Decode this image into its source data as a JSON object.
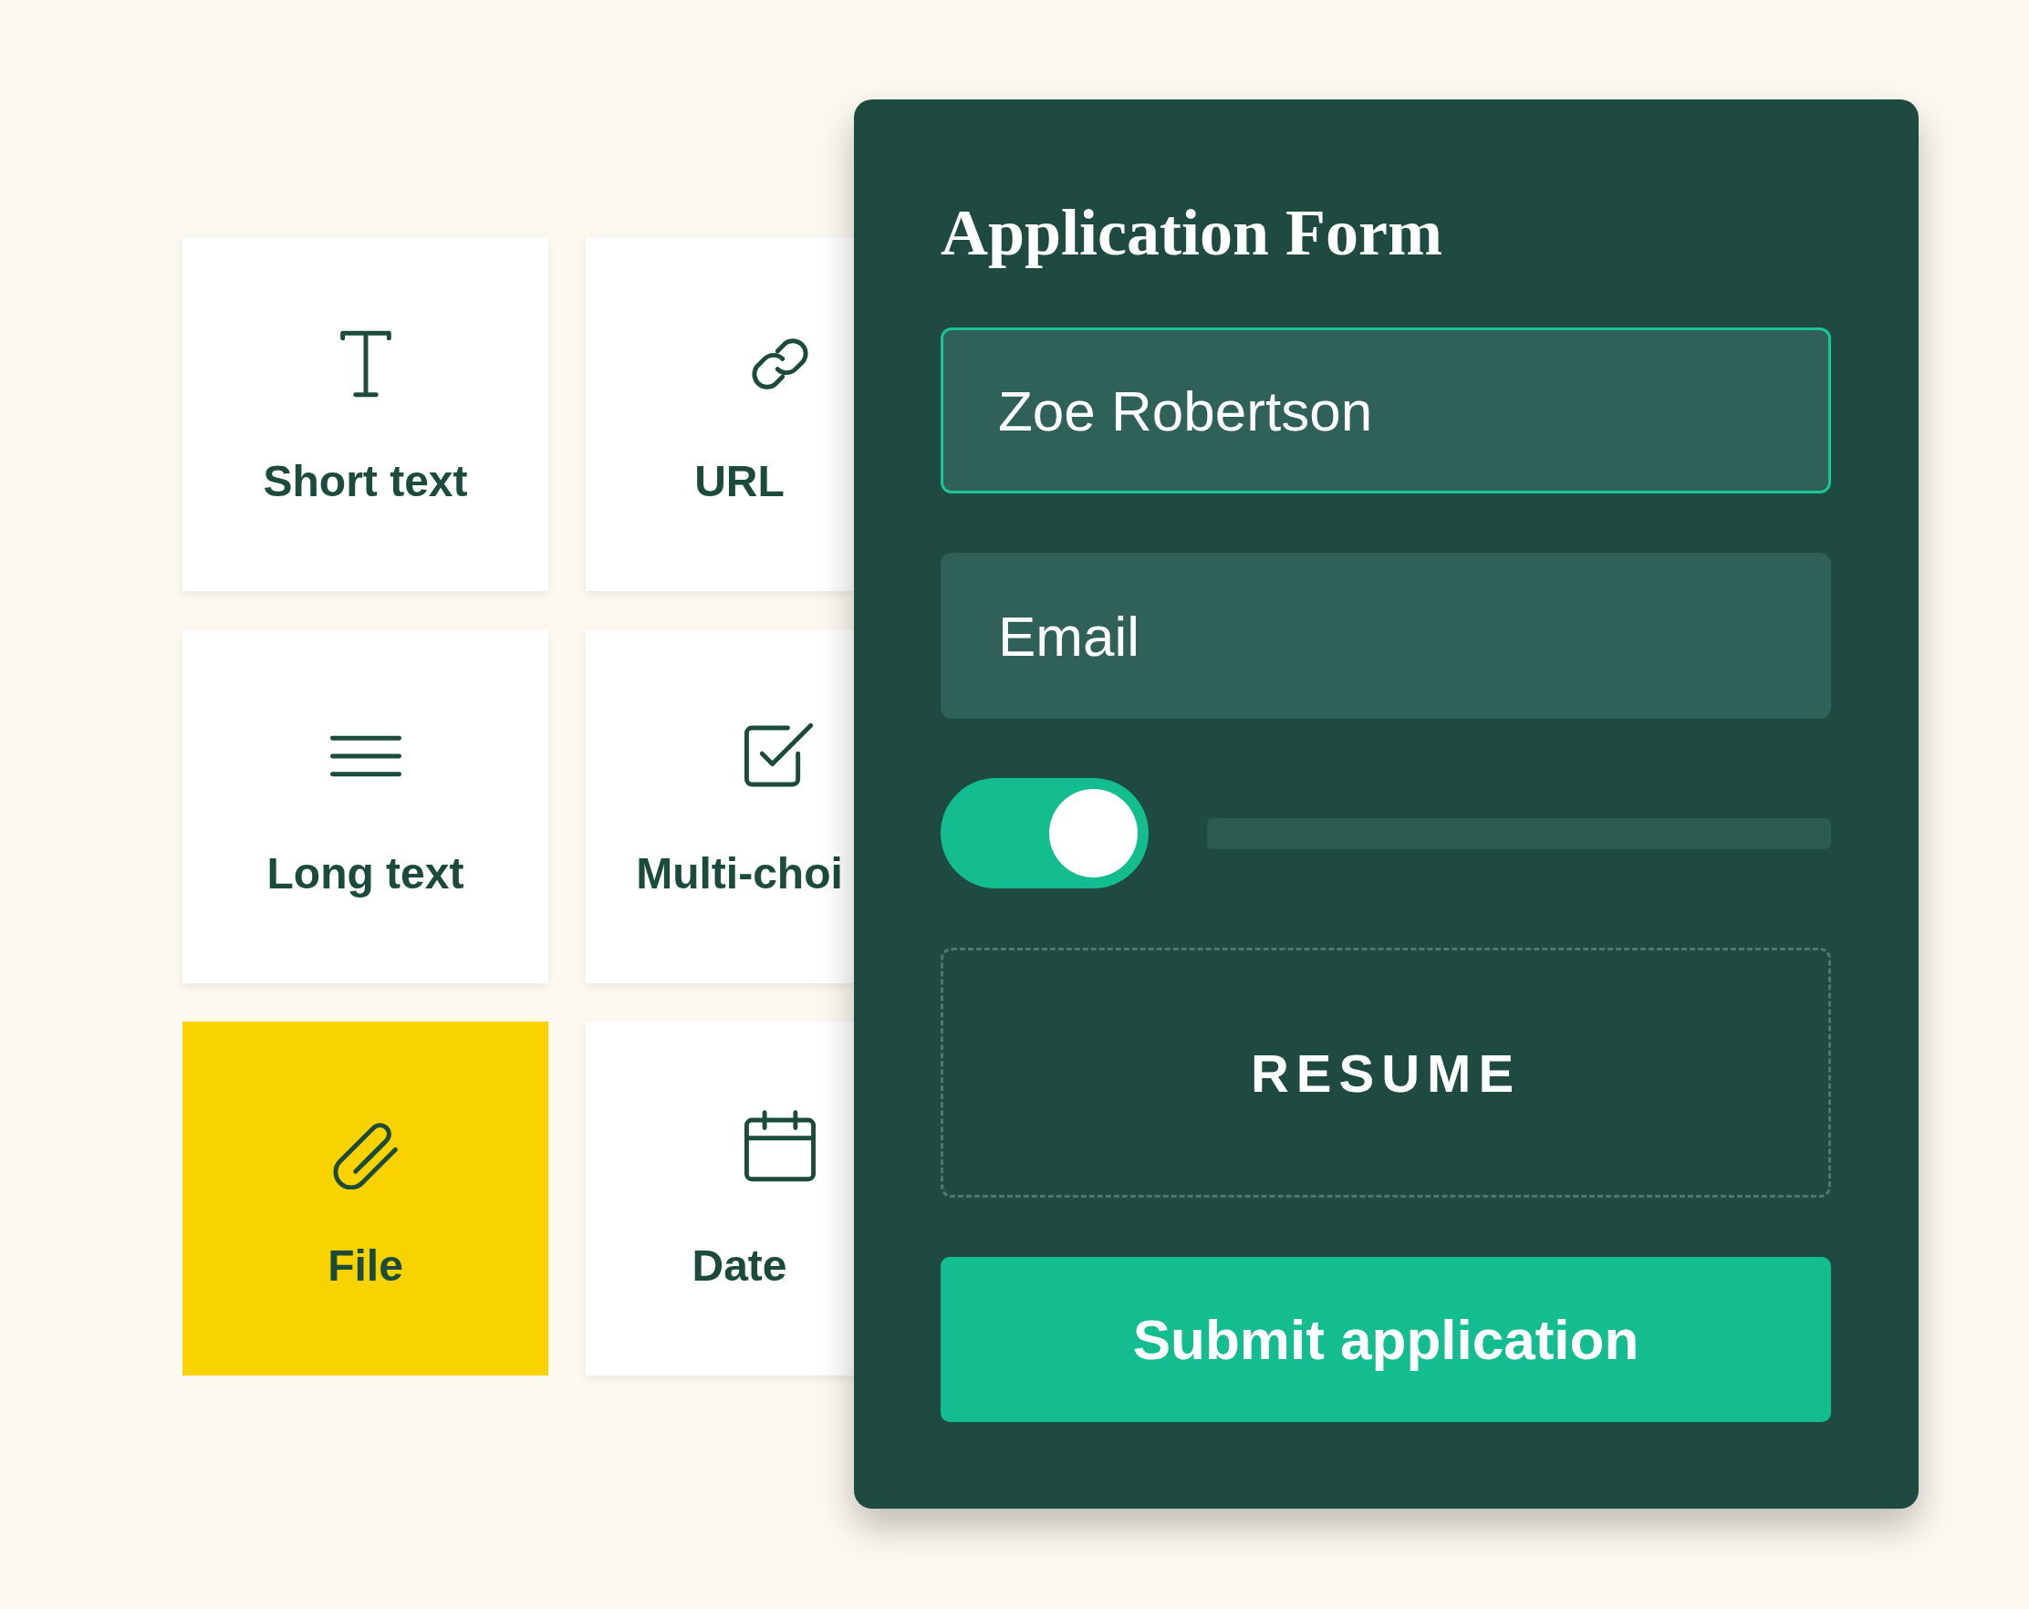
{
  "tiles": [
    {
      "kind": "text",
      "label": "Short text",
      "selected": false
    },
    {
      "kind": "link",
      "label": "URL",
      "selected": false
    },
    {
      "kind": "lines",
      "label": "Long text",
      "selected": false
    },
    {
      "kind": "checkbox",
      "label": "Multi-choi",
      "selected": false
    },
    {
      "kind": "paperclip",
      "label": "File",
      "selected": true
    },
    {
      "kind": "calendar",
      "label": "Date",
      "selected": false
    }
  ],
  "form": {
    "title": "Application Form",
    "fields": [
      {
        "value": "Zoe Robertson",
        "focused": true
      },
      {
        "placeholder": "Email",
        "focused": false
      }
    ],
    "toggle": {
      "on": true
    },
    "upload": {
      "label": "RESUME"
    },
    "submit": {
      "label": "Submit application"
    }
  }
}
